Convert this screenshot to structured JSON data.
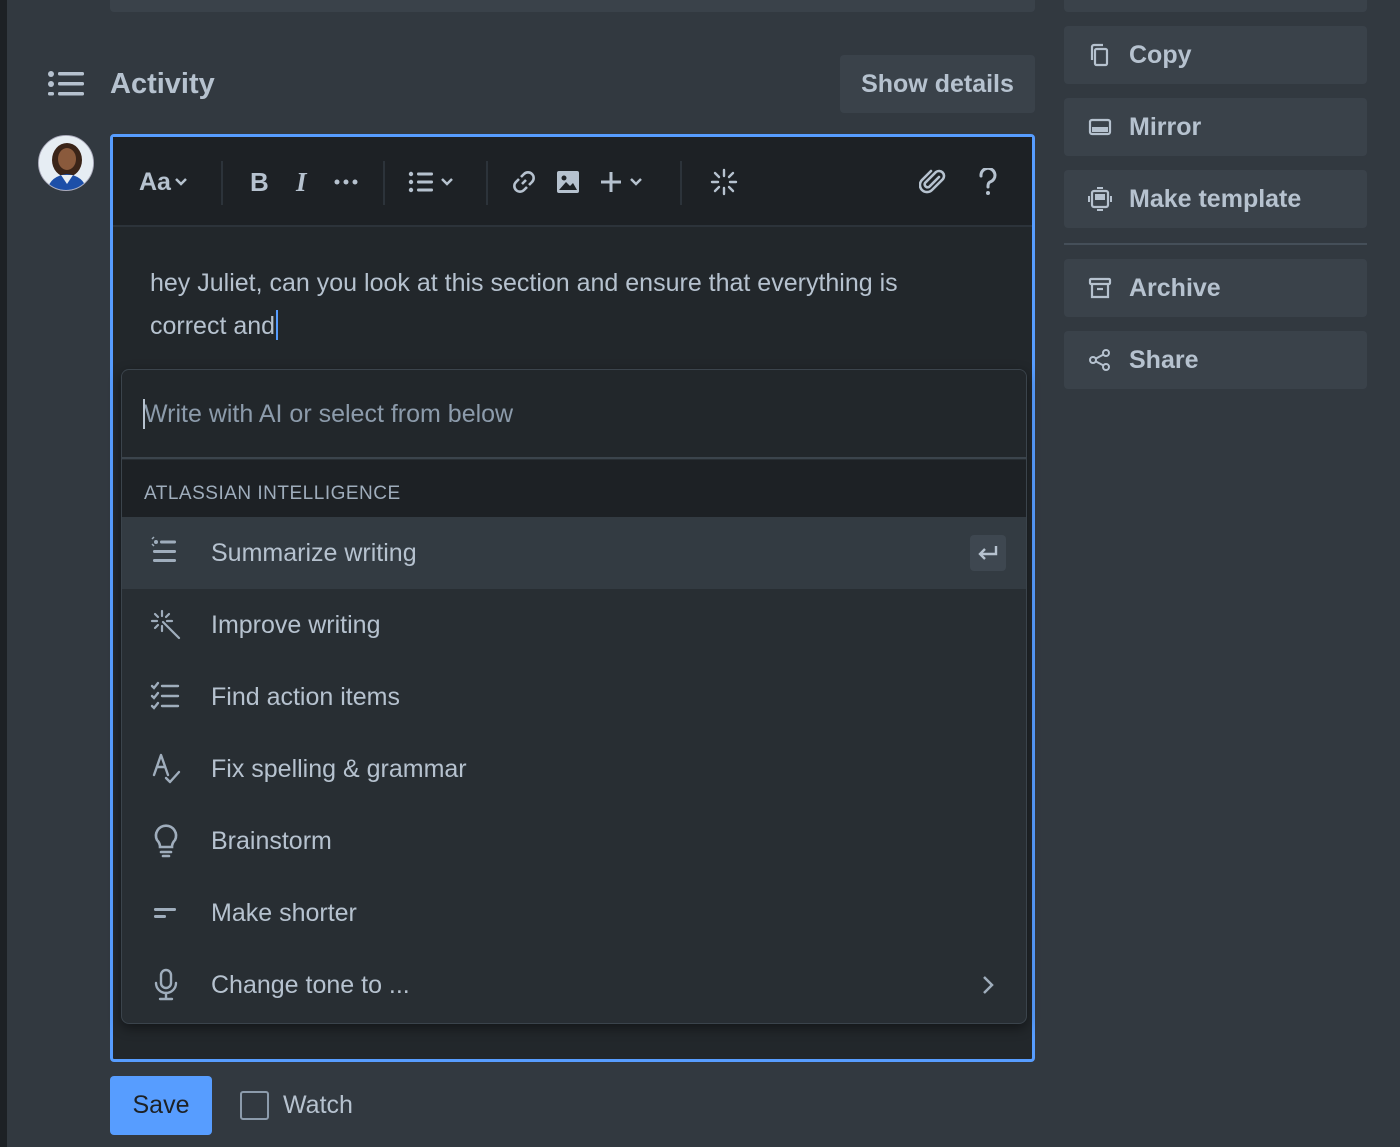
{
  "activity": {
    "title": "Activity",
    "show_details_label": "Show details"
  },
  "editor": {
    "text": "hey Juliet, can you look at this section and ensure that everything is correct and",
    "toolbar": {
      "text_style_label": "Aa",
      "icons": [
        "text-style-icon",
        "bold-icon",
        "italic-icon",
        "more-formatting-icon",
        "list-icon",
        "link-icon",
        "image-icon",
        "insert-icon",
        "ai-sparkle-icon",
        "attachment-icon",
        "help-icon"
      ]
    }
  },
  "ai_menu": {
    "placeholder": "Write with AI or select from below",
    "section_label": "ATLASSIAN INTELLIGENCE",
    "items": [
      {
        "label": "Summarize writing",
        "icon": "summarize-icon",
        "selected": true
      },
      {
        "label": "Improve writing",
        "icon": "magic-wand-icon"
      },
      {
        "label": "Find action items",
        "icon": "checklist-icon"
      },
      {
        "label": "Fix spelling & grammar",
        "icon": "spellcheck-icon"
      },
      {
        "label": "Brainstorm",
        "icon": "lightbulb-icon"
      },
      {
        "label": "Make shorter",
        "icon": "shorten-icon"
      },
      {
        "label": "Change tone to ...",
        "icon": "microphone-icon"
      }
    ]
  },
  "footer": {
    "save_label": "Save",
    "watch_label": "Watch",
    "watch_checked": false
  },
  "sidebar": {
    "actions": [
      {
        "label": "Copy",
        "icon": "copy-icon"
      },
      {
        "label": "Mirror",
        "icon": "mirror-icon"
      },
      {
        "label": "Make template",
        "icon": "template-icon"
      },
      {
        "label": "Archive",
        "icon": "archive-icon"
      },
      {
        "label": "Share",
        "icon": "share-icon"
      }
    ]
  },
  "colors": {
    "background": "#323940",
    "accent": "#579dff",
    "editor_bg": "#22272b",
    "toolbar_bg": "#1d2125"
  }
}
